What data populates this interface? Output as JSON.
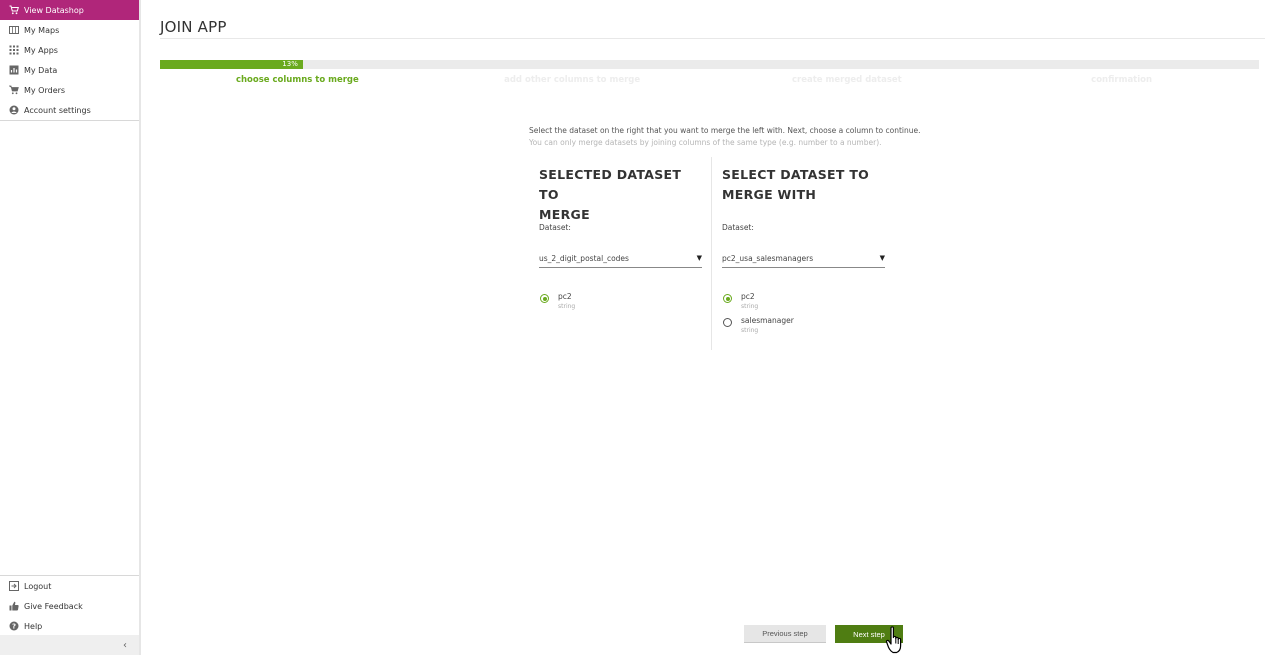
{
  "sidebar": {
    "top_items": [
      {
        "label": "View Datashop",
        "icon": "cart-icon",
        "active": true
      },
      {
        "label": "My Maps",
        "icon": "map-icon",
        "active": false
      },
      {
        "label": "My Apps",
        "icon": "grid-icon",
        "active": false
      },
      {
        "label": "My Data",
        "icon": "chart-icon",
        "active": false
      },
      {
        "label": "My Orders",
        "icon": "cart-icon",
        "active": false
      },
      {
        "label": "Account settings",
        "icon": "user-icon",
        "active": false
      }
    ],
    "bottom_items": [
      {
        "label": "Logout",
        "icon": "logout-icon"
      },
      {
        "label": "Give Feedback",
        "icon": "thumbs-up-icon"
      },
      {
        "label": "Help",
        "icon": "help-icon"
      }
    ],
    "collapse_glyph": "‹"
  },
  "page": {
    "title": "JOIN APP",
    "progress": {
      "value": 0.13,
      "label": "13%"
    },
    "steps": [
      {
        "label": "choose columns to merge",
        "active": true
      },
      {
        "label": "add other columns to merge",
        "active": false
      },
      {
        "label": "create merged dataset",
        "active": false
      },
      {
        "label": "confirmation",
        "active": false
      }
    ],
    "intro_line1": "Select the dataset on the right that you want to merge the left with. Next, choose a column to continue.",
    "intro_line2": "You can only merge datasets by joining columns of the same type (e.g. number to a number).",
    "left_panel": {
      "heading_line1": "SELECTED DATASET TO",
      "heading_line2": "MERGE",
      "dataset_label": "Dataset:",
      "dataset_value": "us_2_digit_postal_codes",
      "columns": [
        {
          "name": "pc2",
          "type": "string",
          "selected": true
        }
      ]
    },
    "right_panel": {
      "heading_line1": "SELECT DATASET TO",
      "heading_line2": "MERGE WITH",
      "dataset_label": "Dataset:",
      "dataset_value": "pc2_usa_salesmanagers",
      "columns": [
        {
          "name": "pc2",
          "type": "string",
          "selected": true
        },
        {
          "name": "salesmanager",
          "type": "string",
          "selected": false
        }
      ]
    },
    "caret_glyph": "▼",
    "buttons": {
      "previous": "Previous step",
      "next": "Next step"
    }
  },
  "colors": {
    "accent_magenta": "#b0267a",
    "accent_green": "#6aaa1e",
    "button_green": "#4f7d12"
  }
}
